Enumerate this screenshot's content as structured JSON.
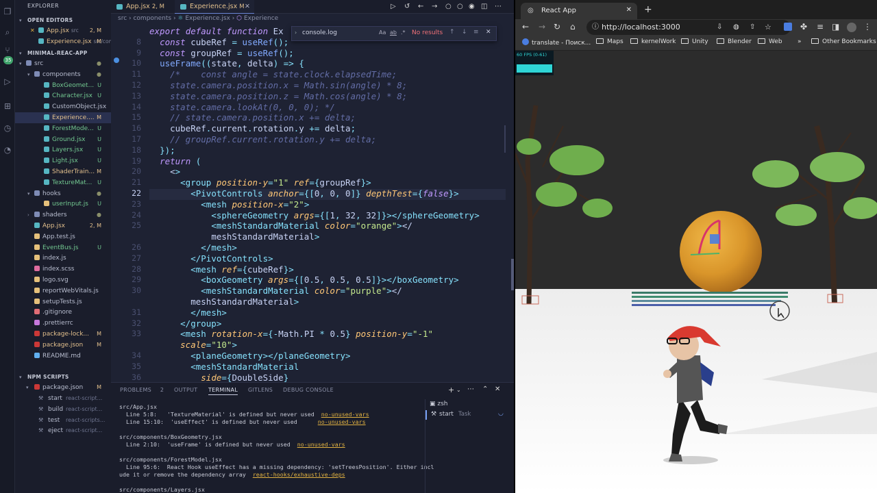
{
  "editor": {
    "explorer_title": "EXPLORER",
    "open_editors_label": "OPEN EDITORS",
    "open_editors": [
      {
        "name": "App.jsx",
        "path": "src",
        "status": "2, M"
      },
      {
        "name": "Experience.jsx",
        "path": "src/com...",
        "status": "M"
      }
    ],
    "project_label": "MINIMAL-REAC-APP",
    "tree": [
      {
        "name": "src",
        "status": "●"
      },
      {
        "name": "components",
        "status": "●"
      },
      {
        "name": "BoxGeomet...",
        "status": "U"
      },
      {
        "name": "Character.jsx",
        "status": "U"
      },
      {
        "name": "CustomObject.jsx",
        "status": ""
      },
      {
        "name": "Experience....",
        "status": "M"
      },
      {
        "name": "ForestMode...",
        "status": "U"
      },
      {
        "name": "Ground.jsx",
        "status": "U"
      },
      {
        "name": "Layers.jsx",
        "status": "U"
      },
      {
        "name": "Light.jsx",
        "status": "U"
      },
      {
        "name": "ShaderTrain...",
        "status": "M"
      },
      {
        "name": "TextureMat...",
        "status": "U"
      },
      {
        "name": "hooks",
        "status": "●"
      },
      {
        "name": "userInput.js",
        "status": "U"
      },
      {
        "name": "shaders",
        "status": "●"
      },
      {
        "name": "App.jsx",
        "status": "2, M"
      },
      {
        "name": "App.test.js",
        "status": ""
      },
      {
        "name": "EventBus.js",
        "status": "U"
      },
      {
        "name": "index.js",
        "status": ""
      },
      {
        "name": "index.scss",
        "status": ""
      },
      {
        "name": "logo.svg",
        "status": ""
      },
      {
        "name": "reportWebVitals.js",
        "status": ""
      },
      {
        "name": "setupTests.js",
        "status": ""
      },
      {
        "name": ".gitignore",
        "status": ""
      },
      {
        "name": ".prettierrc",
        "status": ""
      },
      {
        "name": "package-lock...",
        "status": "M"
      },
      {
        "name": "package.json",
        "status": "M"
      },
      {
        "name": "README.md",
        "status": ""
      }
    ],
    "npm_label": "NPM SCRIPTS",
    "npm_file": "package.json",
    "npm_file_status": "M",
    "npm_scripts": [
      {
        "name": "start",
        "cmd": "react-script..."
      },
      {
        "name": "build",
        "cmd": "react-script..."
      },
      {
        "name": "test",
        "cmd": "react-scripts..."
      },
      {
        "name": "eject",
        "cmd": "react-script..."
      }
    ],
    "source_control_badge": "35",
    "tabs": [
      {
        "label": "App.jsx",
        "status": "2, M"
      },
      {
        "label": "Experience.jsx",
        "status": "M"
      }
    ],
    "breadcrumb": [
      "src",
      "components",
      "Experience.jsx",
      "Experience"
    ],
    "find": {
      "query": "console.log",
      "result": "No results",
      "opt_case": "Aa",
      "opt_word": "ab",
      "opt_regex": ".*"
    },
    "code_lines": [
      {
        "n": "",
        "t": "export default function Ex"
      },
      {
        "n": "8",
        "t": "  const cubeRef = useRef();"
      },
      {
        "n": "9",
        "t": "  const groupRef = useRef();"
      },
      {
        "n": "10",
        "t": "  useFrame((state, delta) => {"
      },
      {
        "n": "11",
        "t": "    /*    const angle = state.clock.elapsedTime;"
      },
      {
        "n": "12",
        "t": "    state.camera.position.x = Math.sin(angle) * 8;"
      },
      {
        "n": "13",
        "t": "    state.camera.position.z = Math.cos(angle) * 8;"
      },
      {
        "n": "14",
        "t": "    state.camera.lookAt(0, 0, 0); */"
      },
      {
        "n": "15",
        "t": "    // state.camera.position.x += delta;"
      },
      {
        "n": "16",
        "t": "    cubeRef.current.rotation.y += delta;"
      },
      {
        "n": "17",
        "t": "    // groupRef.current.rotation.y += delta;"
      },
      {
        "n": "18",
        "t": "  });"
      },
      {
        "n": "19",
        "t": "  return ("
      },
      {
        "n": "20",
        "t": "    <>"
      },
      {
        "n": "21",
        "t": "      <group position-y=\"1\" ref={groupRef}>"
      },
      {
        "n": "22",
        "t": "        <PivotControls anchor={[0, 0, 0]} depthTest={false}>"
      },
      {
        "n": "23",
        "t": "          <mesh position-x=\"2\">"
      },
      {
        "n": "24",
        "t": "            <sphereGeometry args={[1, 32, 32]}></sphereGeometry>"
      },
      {
        "n": "25",
        "t": "            <meshStandardMaterial color=\"orange\"></"
      },
      {
        "n": "",
        "t": "            meshStandardMaterial>"
      },
      {
        "n": "26",
        "t": "          </mesh>"
      },
      {
        "n": "27",
        "t": "        </PivotControls>"
      },
      {
        "n": "28",
        "t": "        <mesh ref={cubeRef}>"
      },
      {
        "n": "29",
        "t": "          <boxGeometry args={[0.5, 0.5, 0.5]}></boxGeometry>"
      },
      {
        "n": "30",
        "t": "          <meshStandardMaterial color=\"purple\"></"
      },
      {
        "n": "",
        "t": "        meshStandardMaterial>"
      },
      {
        "n": "31",
        "t": "        </mesh>"
      },
      {
        "n": "32",
        "t": "      </group>"
      },
      {
        "n": "33",
        "t": "      <mesh rotation-x={-Math.PI * 0.5} position-y=\"-1\""
      },
      {
        "n": "",
        "t": "      scale=\"10\">"
      },
      {
        "n": "34",
        "t": "        <planeGeometry></planeGeometry>"
      },
      {
        "n": "35",
        "t": "        <meshStandardMaterial"
      },
      {
        "n": "36",
        "t": "          side={DoubleSide}"
      }
    ],
    "panel_tabs": [
      "PROBLEMS",
      "OUTPUT",
      "TERMINAL",
      "GITLENS",
      "DEBUG CONSOLE"
    ],
    "problems_count": "2",
    "terminal": [
      {
        "t": "src/App.jsx"
      },
      {
        "t": "  Line 5:8:   'TextureMaterial' is defined but never used  ",
        "r": "no-unused-vars"
      },
      {
        "t": "  Line 15:10:  'useEffect' is defined but never used      ",
        "r": "no-unused-vars"
      },
      {
        "t": ""
      },
      {
        "t": "src/components/BoxGeometry.jsx"
      },
      {
        "t": "  Line 2:10:  'useFrame' is defined but never used  ",
        "r": "no-unused-vars"
      },
      {
        "t": ""
      },
      {
        "t": "src/components/ForestModel.jsx"
      },
      {
        "t": "  Line 95:6:  React Hook useEffect has a missing dependency: 'setTreesPosition'. Either incl"
      },
      {
        "t": "ude it or remove the dependency array  ",
        "r": "react-hooks/exhaustive-deps"
      },
      {
        "t": ""
      },
      {
        "t": "src/components/Layers.jsx"
      }
    ],
    "terminals": [
      {
        "name": "zsh",
        "sub": ""
      },
      {
        "name": "start",
        "sub": "Task"
      }
    ]
  },
  "browser": {
    "tab_title": "React App",
    "url": "http://localhost:3000",
    "bookmarks": [
      "translate - Поиск...",
      "Maps",
      "kernelWork",
      "Unity",
      "Blender",
      "Web"
    ],
    "other_bookmarks": "Other Bookmarks",
    "more_bookmarks": "»",
    "fps_label": "60 FPS (0-61)"
  },
  "colors": {
    "editor_bg": "#1e2233",
    "keyword": "#c099ff",
    "func": "#82aaff",
    "string": "#c3e88d",
    "tag": "#86e1fc",
    "attr": "#ffc777",
    "comment": "#636da6",
    "sphere": "#e8a630",
    "sky": "#2c2c2c",
    "ground": "#f2f2f2"
  }
}
